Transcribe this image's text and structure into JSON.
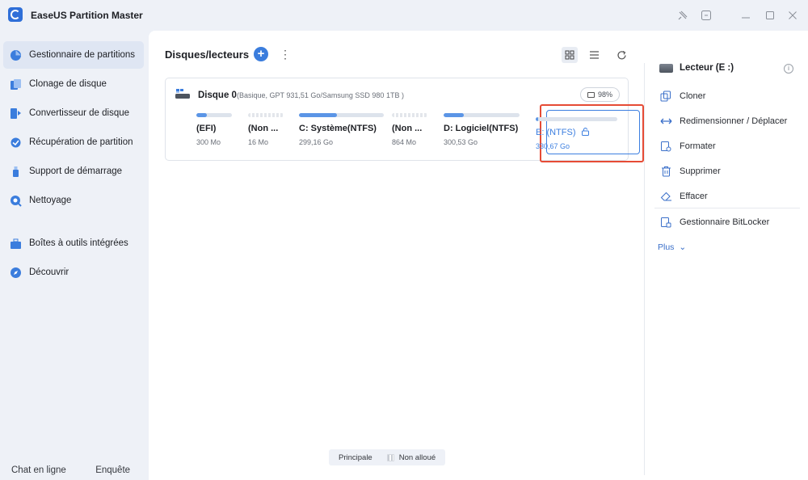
{
  "app": {
    "title": "EaseUS Partition Master"
  },
  "window_controls": [
    "pin-icon",
    "feedback-icon",
    "minimize-icon",
    "maximize-icon",
    "close-icon"
  ],
  "sidebar": {
    "items": [
      {
        "label": "Gestionnaire de partitions",
        "icon": "partition-pie-icon",
        "active": true
      },
      {
        "label": "Clonage de disque",
        "icon": "clone-disk-icon"
      },
      {
        "label": "Convertisseur de disque",
        "icon": "convert-disk-icon"
      },
      {
        "label": "Récupération de partition",
        "icon": "recovery-icon"
      },
      {
        "label": "Support de démarrage",
        "icon": "usb-boot-icon"
      },
      {
        "label": "Nettoyage",
        "icon": "cleanup-icon"
      },
      {
        "label": "Boîtes à outils intégrées",
        "icon": "toolbox-icon"
      },
      {
        "label": "Découvrir",
        "icon": "compass-icon"
      }
    ],
    "footer": {
      "chat": "Chat en ligne",
      "survey": "Enquête"
    }
  },
  "main": {
    "title": "Disques/lecteurs",
    "disk": {
      "name": "Disque 0",
      "info": "(Basique, GPT 931,51 Go/Samsung SSD 980 1TB )",
      "health": "98%",
      "partitions": [
        {
          "name": "(EFI)",
          "size": "300 Mo",
          "type": "primary",
          "used": 0.3
        },
        {
          "name": "(Non ...",
          "size": "16 Mo",
          "type": "unallocated",
          "used": 0
        },
        {
          "name": "C: Système(NTFS)",
          "size": "299,16 Go",
          "type": "primary",
          "used": 0.45
        },
        {
          "name": "(Non ...",
          "size": "864 Mo",
          "type": "unallocated",
          "used": 0
        },
        {
          "name": "D: Logiciel(NTFS)",
          "size": "300,53 Go",
          "type": "primary",
          "used": 0.27
        },
        {
          "name": "E: (NTFS)",
          "size": "330,67 Go",
          "type": "primary",
          "used": 0.02,
          "selected": true
        }
      ]
    },
    "legend": {
      "primary": "Principale",
      "unallocated": "Non alloué"
    },
    "colors": {
      "primary": "#5b95e6",
      "accent": "#3d7fe0",
      "highlight": "#e64b35"
    }
  },
  "right_panel": {
    "title": "Lecteur (E :)",
    "actions": [
      {
        "label": "Cloner",
        "icon": "clone-icon"
      },
      {
        "label": "Redimensionner / Déplacer",
        "icon": "resize-icon"
      },
      {
        "label": "Formater",
        "icon": "format-icon"
      },
      {
        "label": "Supprimer",
        "icon": "trash-icon"
      },
      {
        "label": "Effacer",
        "icon": "eraser-icon"
      },
      {
        "label": "Gestionnaire BitLocker",
        "icon": "bitlocker-icon"
      }
    ],
    "more": "Plus"
  }
}
